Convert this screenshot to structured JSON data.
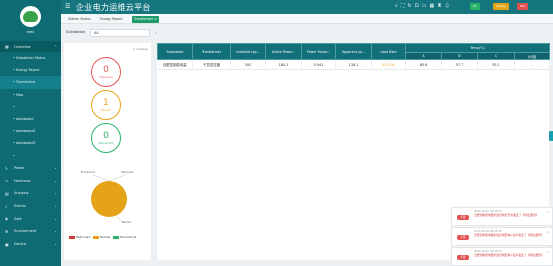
{
  "sidebar": {
    "user_name": "test",
    "nav": [
      {
        "label": "Overview",
        "icon": "grid-icon",
        "kind": "top"
      },
      {
        "label": "• Substation Status",
        "kind": "sub"
      },
      {
        "label": "• Energy Report",
        "kind": "sub"
      },
      {
        "label": "• Transformer",
        "kind": "sub",
        "active": true
      },
      {
        "label": "• Map",
        "kind": "sub"
      },
      {
        "label": "•",
        "kind": "sub"
      },
      {
        "label": "• dashboard",
        "kind": "sub"
      },
      {
        "label": "• dashboard2",
        "kind": "sub"
      },
      {
        "label": "• dashboard3",
        "kind": "sub"
      },
      {
        "label": "•",
        "kind": "sub"
      },
      {
        "label": "Power",
        "icon": "bolt-icon",
        "kind": "group"
      },
      {
        "label": "Harmonic",
        "icon": "wave-icon",
        "kind": "group"
      },
      {
        "label": "Analysis",
        "icon": "chart-icon",
        "kind": "group"
      },
      {
        "label": "Events",
        "icon": "bell-icon",
        "kind": "group"
      },
      {
        "label": "Safe",
        "icon": "shield-icon",
        "kind": "group"
      },
      {
        "label": "Environment",
        "icon": "leaf-icon",
        "kind": "group"
      },
      {
        "label": "Device",
        "icon": "device-icon",
        "kind": "group"
      }
    ]
  },
  "header": {
    "title": "企业电力运维云平台",
    "badges": [
      {
        "label": "Zh",
        "color": "#27b469"
      },
      {
        "label": "Setting",
        "color": "#e5a417"
      },
      {
        "label": "Exit",
        "color": "#e35050"
      }
    ]
  },
  "tabs": [
    {
      "label": "Station Status"
    },
    {
      "label": "Energy Report"
    },
    {
      "label": "Transformer ×",
      "active": true
    }
  ],
  "filter": {
    "label": "Substation",
    "value": "All"
  },
  "left_panel": {
    "expand_label": "Collapse",
    "stats": [
      {
        "value": "0",
        "label": "High Load",
        "color": "#e45656"
      },
      {
        "value": "1",
        "label": "Normal",
        "color": "#e5a417"
      },
      {
        "value": "0",
        "label": "Economical",
        "color": "#27b469"
      }
    ],
    "pie_labels": {
      "economical": "Economical",
      "high_load": "High Load",
      "normal": "Normal"
    },
    "legend": [
      {
        "label": "High Load",
        "color": "#d93838"
      },
      {
        "label": "Normal",
        "color": "#e5a417"
      },
      {
        "label": "Economical",
        "color": "#27b469"
      }
    ]
  },
  "table": {
    "headers": [
      "Substation",
      "Transformer",
      "Installed cap...",
      "Active Power...",
      "Power Factor...",
      "Apparent po...",
      "Load Rate"
    ],
    "temp_group": "Temp(℃)",
    "temp_sub": [
      "A",
      "B",
      "C",
      "(N)值"
    ],
    "rows": [
      [
        "合肥控制能电量",
        "干变变压器",
        "50C",
        "180.1",
        "0.941",
        "136.1",
        "51.02%",
        "65.6",
        "57.7",
        "55.1",
        "-"
      ]
    ]
  },
  "toasts": [
    {
      "tag": "告警",
      "time": "2021-09-10 09:45:56",
      "message": "合肥控制能电量的温控制方开关发生了【所在遭到】"
    },
    {
      "tag": "告警",
      "time": "2021-09-10 09:45:56",
      "message": "合肥控制能电量的温控制配电+接声发生了【所在遭到】"
    },
    {
      "tag": "告警",
      "time": "2021-09-10 09:45:56",
      "message": "合肥控制能电量的温控制配电+接声发生了【所在遭到】"
    }
  ]
}
